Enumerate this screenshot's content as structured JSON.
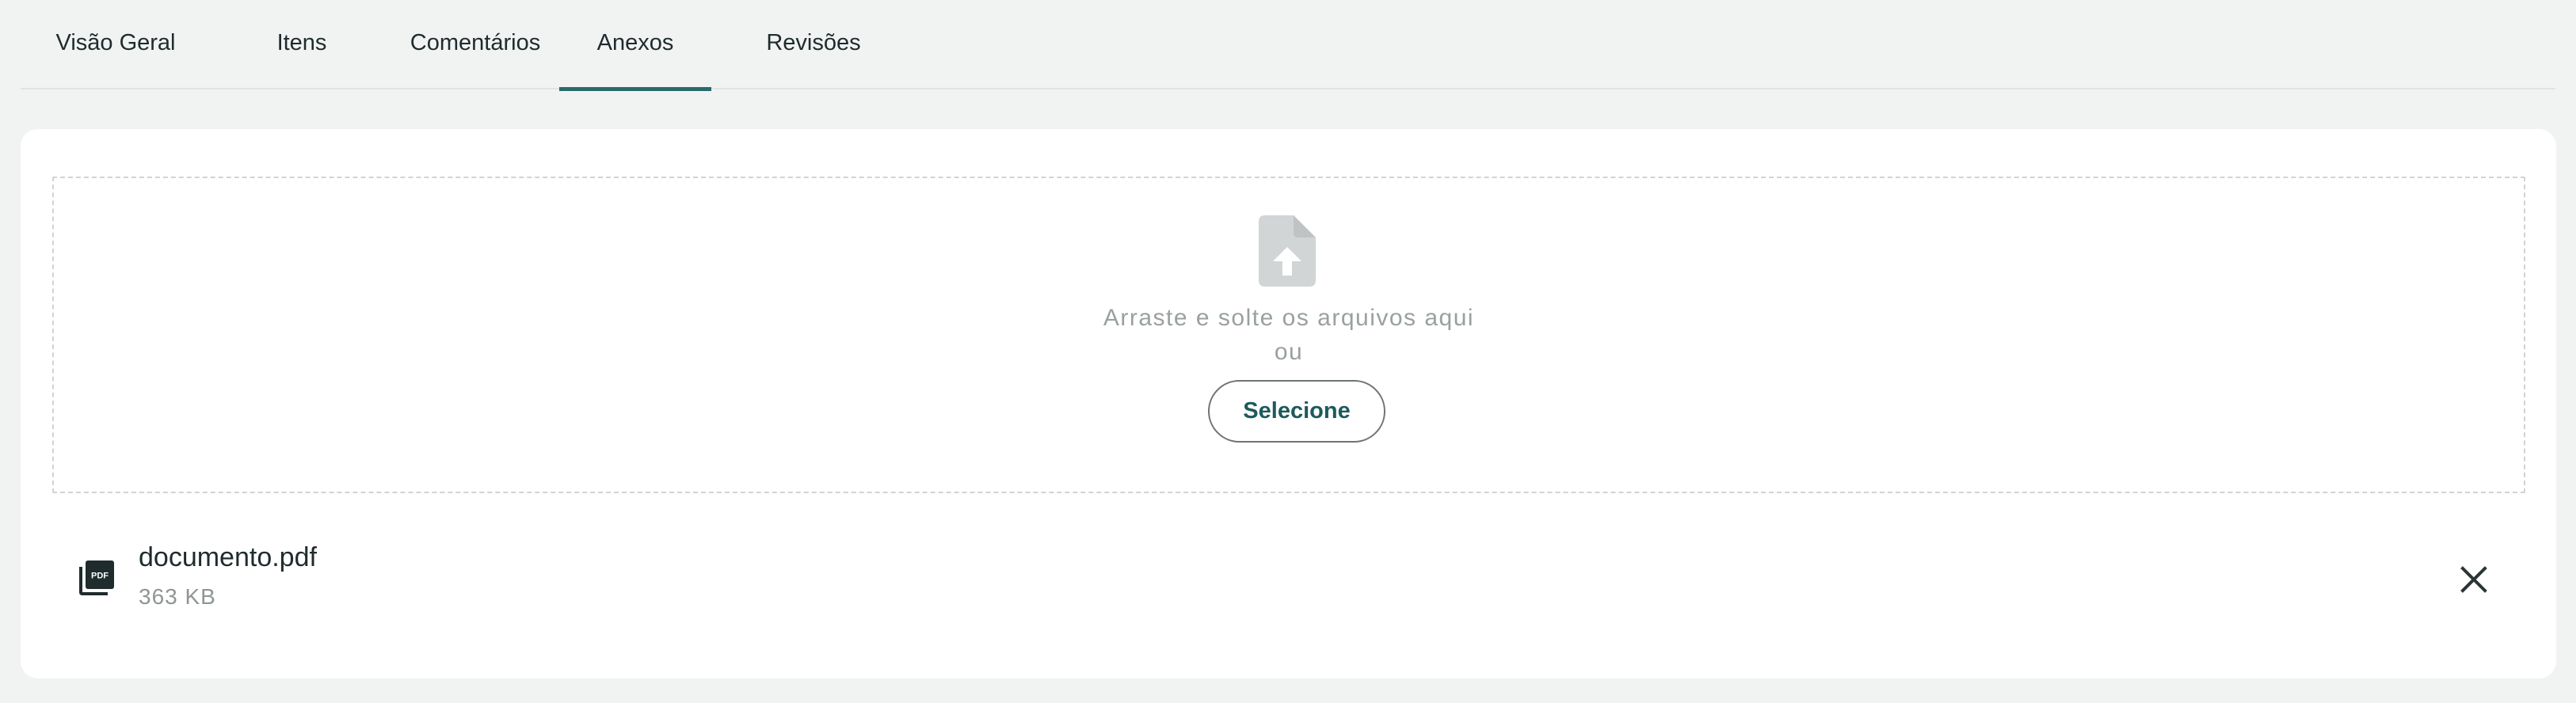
{
  "tabs": [
    {
      "label": "Visão Geral",
      "active": false
    },
    {
      "label": "Itens",
      "active": false
    },
    {
      "label": "Comentários",
      "active": false
    },
    {
      "label": "Anexos",
      "active": true
    },
    {
      "label": "Revisões",
      "active": false
    }
  ],
  "dropzone": {
    "icon": "file-upload-icon",
    "instruction": "Arraste e solte os arquivos aqui",
    "or_label": "ou",
    "select_label": "Selecione"
  },
  "files": [
    {
      "icon": "pdf-icon",
      "name": "documento.pdf",
      "size": "363 KB",
      "remove_icon": "close-icon"
    }
  ],
  "colors": {
    "accent": "#2a6a6c",
    "button_text": "#1d5a5c",
    "background": "#f1f3f2",
    "muted_text": "#9aa0a0"
  }
}
